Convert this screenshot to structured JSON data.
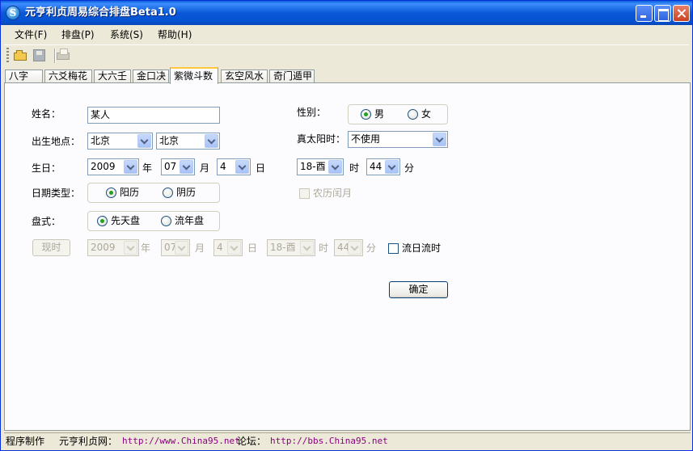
{
  "window": {
    "title": "元亨利贞周易综合排盘Beta1.0"
  },
  "menu": [
    {
      "label": "文件(F)"
    },
    {
      "label": "排盘(P)"
    },
    {
      "label": "系统(S)"
    },
    {
      "label": "帮助(H)"
    }
  ],
  "toolbar": {
    "icons": [
      "open-folder-icon",
      "save-icon",
      "print-icon"
    ]
  },
  "tabs": [
    {
      "label": "八字"
    },
    {
      "label": "六爻梅花"
    },
    {
      "label": "大六壬"
    },
    {
      "label": "金口决"
    },
    {
      "label": "紫微斗数",
      "active": true
    },
    {
      "label": "玄空风水"
    },
    {
      "label": "奇门遁甲"
    }
  ],
  "form": {
    "name_label": "姓名：",
    "name_value": "某人",
    "gender_label": "性别：",
    "gender_male": "男",
    "gender_female": "女",
    "gender_selected": "男",
    "birthplace_label": "出生地点：",
    "province": "北京",
    "city": "北京",
    "solar_time_label": "真太阳时：",
    "solar_time_value": "不使用",
    "birthday_label": "生日：",
    "year": "2009",
    "year_unit": "年",
    "month": "07",
    "month_unit": "月",
    "day": "4",
    "day_unit": "日",
    "hour": "18-酉",
    "hour_unit": "时",
    "minute": "44",
    "minute_unit": "分",
    "date_type_label": "日期类型：",
    "solar_calendar": "阳历",
    "lunar_calendar": "阴历",
    "date_type_selected": "阳历",
    "leap_month": "农历闰月",
    "chart_type_label": "盘式：",
    "chart_innate": "先天盘",
    "chart_flowing": "流年盘",
    "chart_type_selected": "先天盘",
    "now_button": "现时",
    "flow_year": "2009",
    "flow_month": "07",
    "flow_day": "4",
    "flow_hour": "18-酉",
    "flow_minute": "44",
    "flow_day_checkbox": "流日流时",
    "ok_button": "确定"
  },
  "status": {
    "author": "程序制作",
    "site_label": "元亨利贞网：",
    "site_url": "http://www.China95.net",
    "forum_label": "论坛：",
    "forum_url": "http://bbs.China95.net"
  },
  "colors": {
    "title_bar": "#0a58d8",
    "window_bg": "#ece9d8",
    "panel_bg": "#fcfcfe",
    "active_tab_accent": "#ffc83c",
    "radio_dot": "#21a121",
    "status_link": "#8b0080"
  }
}
